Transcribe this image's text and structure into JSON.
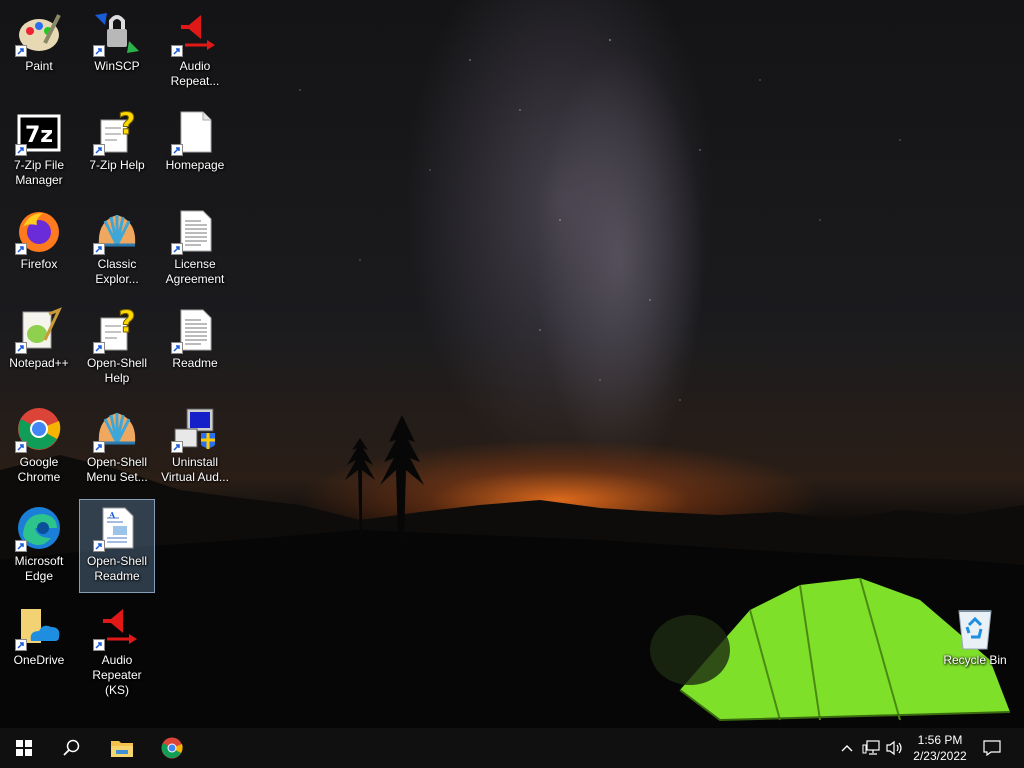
{
  "desktop": {
    "icons": [
      {
        "label": "Paint",
        "icon": "paint-icon"
      },
      {
        "label": "WinSCP",
        "icon": "winscp-icon"
      },
      {
        "label": "Audio Repeat...",
        "icon": "audio-repeater-icon"
      },
      {
        "label": "7-Zip File Manager",
        "icon": "7zip-icon"
      },
      {
        "label": "7-Zip Help",
        "icon": "help-file-icon"
      },
      {
        "label": "Homepage",
        "icon": "blank-document-icon"
      },
      {
        "label": "Firefox",
        "icon": "firefox-icon"
      },
      {
        "label": "Classic Explor...",
        "icon": "shell-icon"
      },
      {
        "label": "License Agreement",
        "icon": "text-document-icon"
      },
      {
        "label": "Notepad++",
        "icon": "notepadpp-icon"
      },
      {
        "label": "Open-Shell Help",
        "icon": "help-file-icon"
      },
      {
        "label": "Readme",
        "icon": "text-document-icon"
      },
      {
        "label": "Google Chrome",
        "icon": "chrome-icon"
      },
      {
        "label": "Open-Shell Menu Set...",
        "icon": "shell-icon"
      },
      {
        "label": "Uninstall Virtual Aud...",
        "icon": "uninstall-icon"
      },
      {
        "label": "Microsoft Edge",
        "icon": "edge-icon"
      },
      {
        "label": "Open-Shell Readme",
        "icon": "wordpad-document-icon"
      },
      {
        "label": "OneDrive",
        "icon": "onedrive-folder-icon"
      },
      {
        "label": "Audio Repeater (KS)",
        "icon": "audio-repeater-icon"
      },
      {
        "label": "Recycle Bin",
        "icon": "recycle-bin-icon"
      }
    ],
    "selected": "Open-Shell Readme"
  },
  "taskbar": {
    "start_icon": "windows-start-icon",
    "search_icon": "search-icon",
    "pinned": [
      "file-explorer-icon",
      "chrome-icon"
    ],
    "tray_icons": [
      "chevron-up-icon",
      "network-icon",
      "volume-icon"
    ],
    "time": "1:56 PM",
    "date": "2/23/2022",
    "notification_icon": "action-center-icon"
  },
  "colors": {
    "taskbar": "#101010",
    "sky_glow": "#ff7a1e",
    "tent": "#7fe02a",
    "selection": "#78a0c8"
  }
}
